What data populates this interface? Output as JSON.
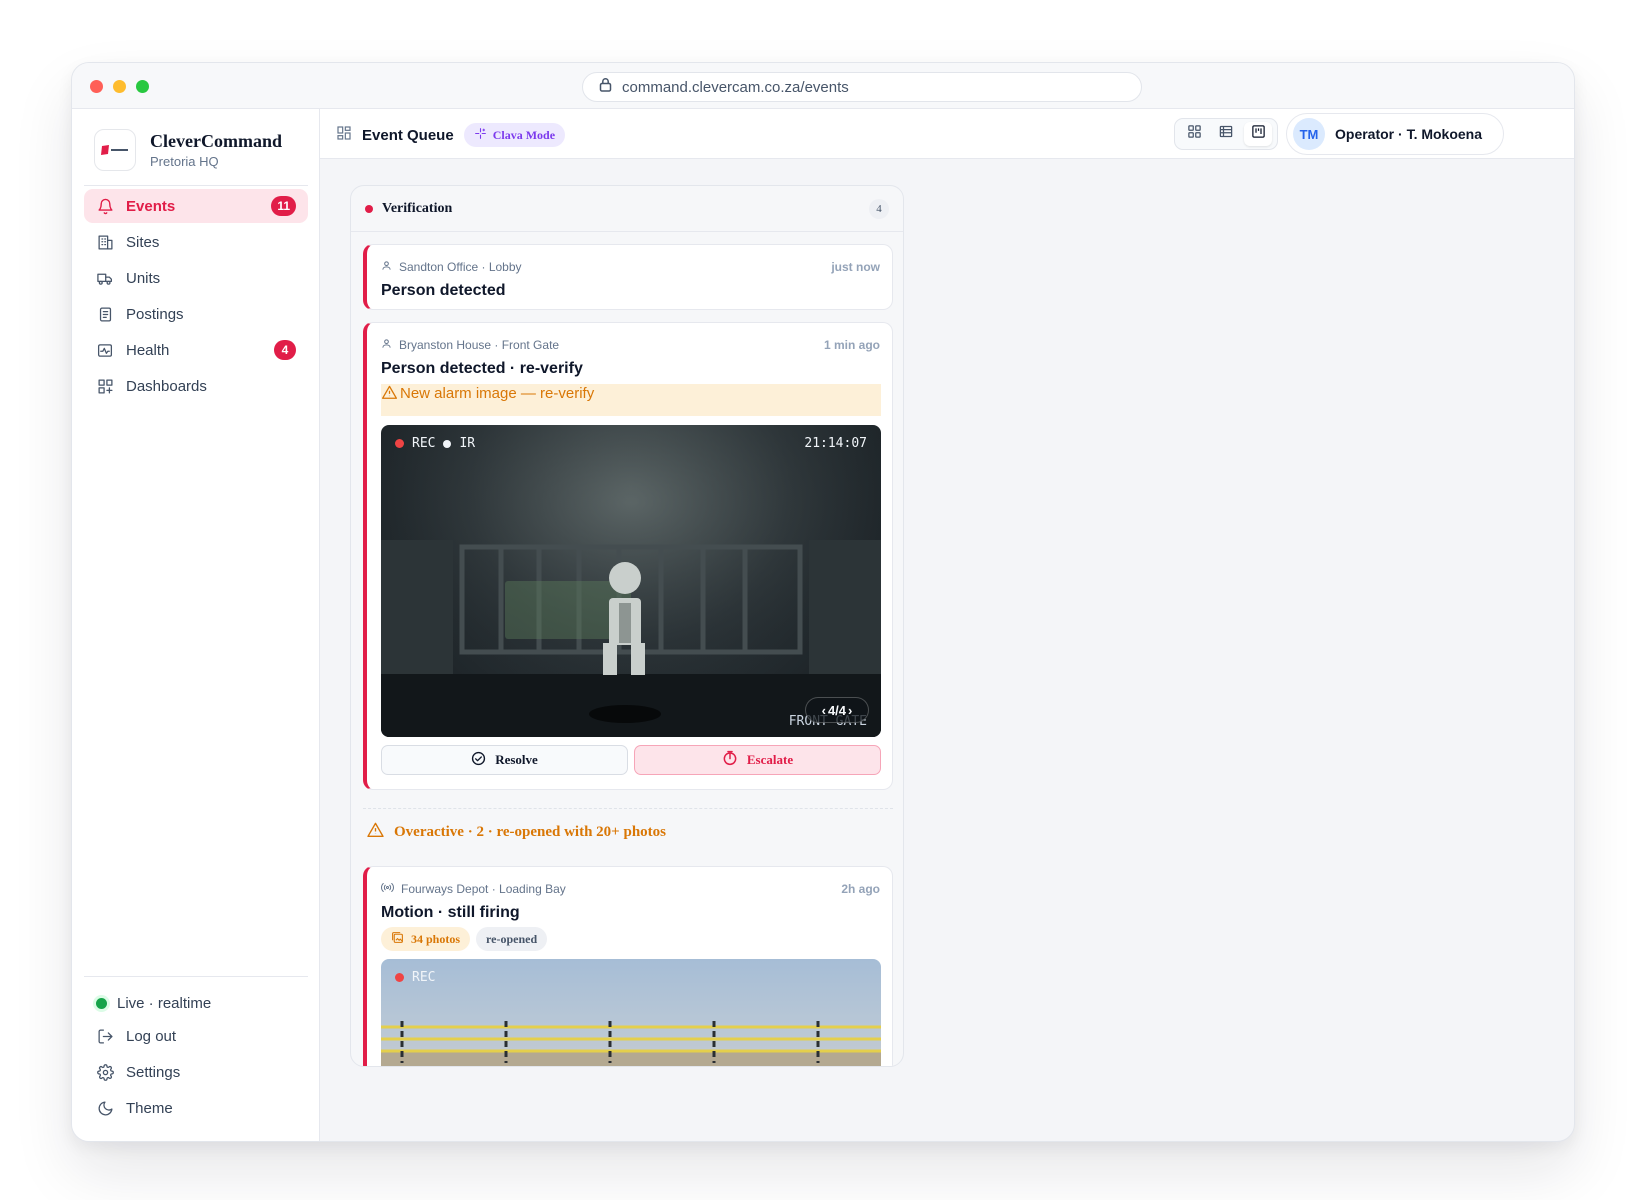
{
  "browser": {
    "url": "command.clevercam.co.za/events"
  },
  "brand": {
    "name": "CleverCommand",
    "subtitle": "Pretoria HQ"
  },
  "nav": {
    "items": [
      {
        "label": "Events",
        "icon": "bell-icon",
        "badge": "11",
        "active": true
      },
      {
        "label": "Sites",
        "icon": "building-icon"
      },
      {
        "label": "Units",
        "icon": "truck-icon"
      },
      {
        "label": "Postings",
        "icon": "clipboard-icon"
      },
      {
        "label": "Health",
        "icon": "activity-icon",
        "badge": "4"
      },
      {
        "label": "Dashboards",
        "icon": "grid-plus-icon"
      }
    ],
    "bottom": {
      "live": "Live · realtime",
      "logout": "Log out",
      "settings": "Settings",
      "theme": "Theme"
    }
  },
  "topbar": {
    "title": "Event Queue",
    "mode": "Clava Mode",
    "operator_initials": "TM",
    "operator_name": "Operator · T. Mokoena"
  },
  "column": {
    "title": "Verification",
    "count": "4",
    "accent": "#e11d48"
  },
  "events": [
    {
      "location": "Sandton Office · Lobby",
      "time": "just now",
      "title": "Person detected",
      "icon": "person-icon"
    },
    {
      "location": "Bryanston House · Front Gate",
      "time": "1 min ago",
      "title": "Person detected · re-verify",
      "icon": "person-icon",
      "warning": "New alarm image — re-verify",
      "camera": {
        "rec": "REC",
        "ir": "IR",
        "timestamp": "21:14:07",
        "label": "FRONT GATE",
        "pager": "4/4"
      },
      "actions": {
        "resolve": "Resolve",
        "escalate": "Escalate"
      }
    },
    {
      "location": "Fourways Depot · Loading Bay",
      "time": "2h ago",
      "title": "Motion · still firing",
      "icon": "motion-sensor-icon",
      "chips": {
        "photos": "34 photos",
        "reopened": "re-opened"
      },
      "camera": {
        "rec": "REC"
      }
    }
  ],
  "overactive": {
    "text": "Overactive · 2 · re-opened with 20+ photos",
    "color": "#d97706"
  }
}
